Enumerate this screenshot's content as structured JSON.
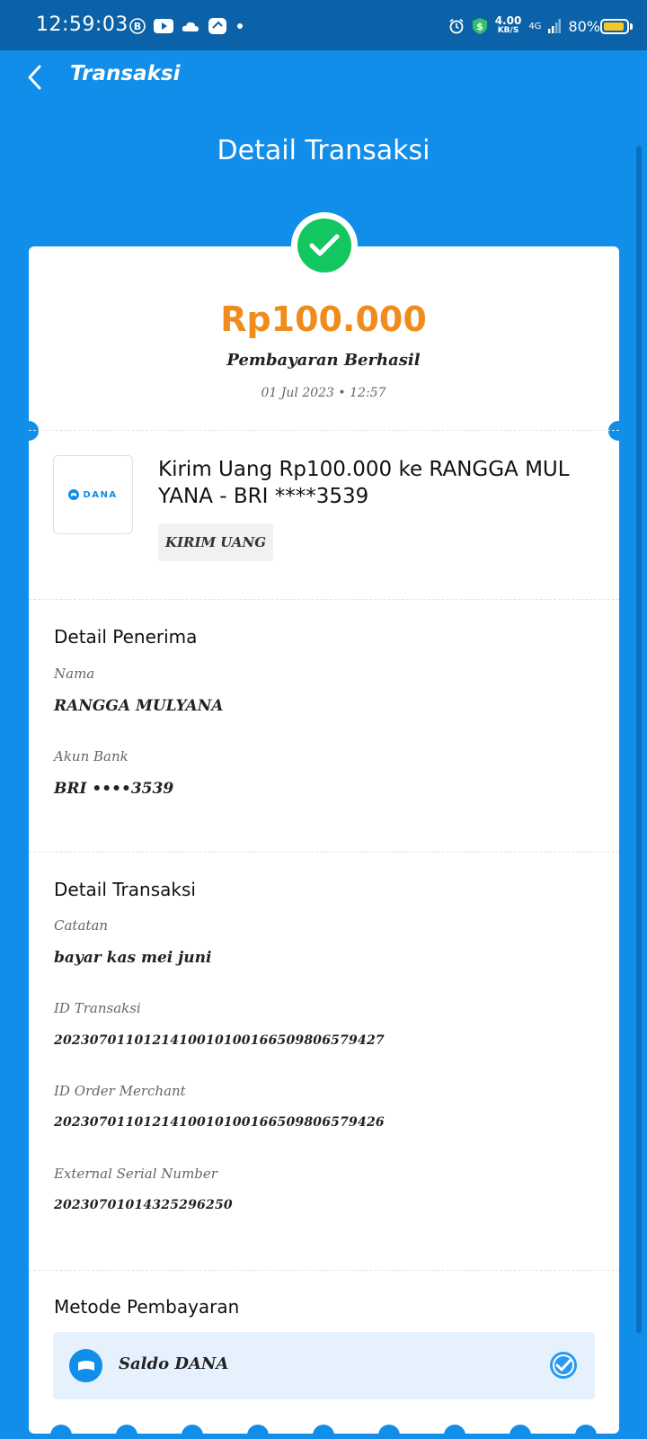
{
  "status_bar": {
    "time": "12:59:03",
    "speed_value": "4.00",
    "speed_unit": "KB/S",
    "network": "4G",
    "battery": "80%"
  },
  "app_bar": {
    "title": "Transaksi"
  },
  "page_heading": "Detail Transaksi",
  "summary": {
    "amount": "Rp100.000",
    "status": "Pembayaran Berhasil",
    "date": "01 Jul 2023 • 12:57"
  },
  "transaction": {
    "logo_text": "DANA",
    "title": "Kirim Uang Rp100.000 ke RANGGA MUL YANA - BRI ****3539",
    "tag": "KIRIM UANG"
  },
  "recipient": {
    "section_title": "Detail Penerima",
    "name_label": "Nama",
    "name_value": "RANGGA MULYANA",
    "bank_label": "Akun Bank",
    "bank_value": "BRI ••••3539"
  },
  "details": {
    "section_title": "Detail Transaksi",
    "note_label": "Catatan",
    "note_value": "bayar kas mei juni",
    "tx_id_label": "ID Transaksi",
    "tx_id_value": "2023070110121410010100166509806579427",
    "order_id_label": "ID Order Merchant",
    "order_id_value": "2023070110121410010100166509806579426",
    "serial_label": "External Serial Number",
    "serial_value": "20230701014325296250"
  },
  "payment": {
    "section_title": "Metode Pembayaran",
    "method": "Saldo DANA"
  },
  "colors": {
    "brand_blue": "#118dea",
    "amount_orange": "#f08c1d",
    "success_green": "#12c75f"
  }
}
